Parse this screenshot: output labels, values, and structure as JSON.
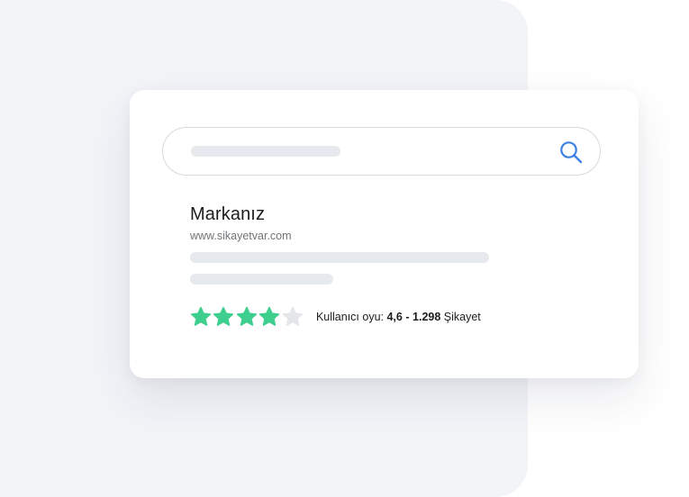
{
  "colors": {
    "backdrop": "#f3f4f8",
    "card": "#ffffff",
    "skeleton": "#e6e9ed",
    "search_icon": "#3b82e6",
    "star_filled": "#3ecf8e",
    "star_empty": "#e4e6ea"
  },
  "search": {
    "icon": "search-icon"
  },
  "result": {
    "title": "Markanız",
    "url": "www.sikayetvar.com"
  },
  "rating": {
    "stars_filled": 4,
    "stars_total": 5,
    "label": "Kullanıcı oyu:",
    "score": "4,6",
    "separator": "-",
    "count": "1.298",
    "count_label": "Şikayet"
  }
}
